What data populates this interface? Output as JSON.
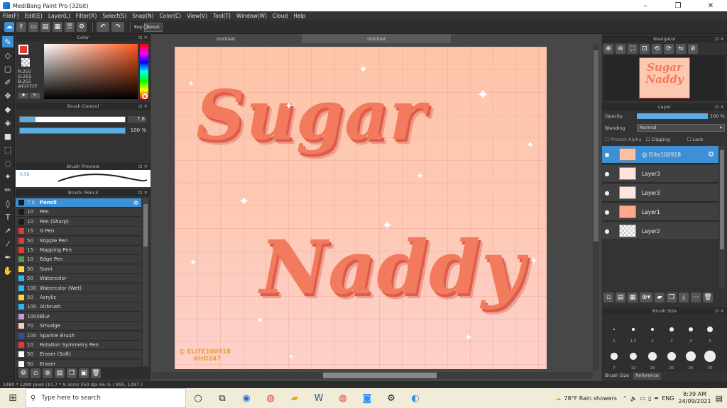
{
  "window": {
    "title": "MediBang Paint Pro (32bit)",
    "controls": [
      "–",
      "❐",
      "✕"
    ]
  },
  "menu": [
    "File(F)",
    "Edit(E)",
    "Layer(L)",
    "Filter(R)",
    "Select(S)",
    "Snap(N)",
    "Color(C)",
    "View(V)",
    "Tool(T)",
    "Window(W)",
    "Cloud",
    "Help"
  ],
  "toolbar": {
    "key_label": "Key",
    "reset_label": "Reset"
  },
  "tabs": {
    "tab1": "Untitled",
    "tab2": "Untitled"
  },
  "color_panel": {
    "title": "Color",
    "r": "R:255",
    "g": "G:255",
    "b": "B:255",
    "hex": "#FFFFFF"
  },
  "brush_control": {
    "title": "Brush Control",
    "size": "7.8",
    "opacity": "100 %",
    "size_fraction": 0.15,
    "opacity_fraction": 1.0
  },
  "brush_preview": {
    "title": "Brush Preview",
    "size": "0.56"
  },
  "brush_list": {
    "title": "Brush: Pencil",
    "items": [
      {
        "size": "7.8",
        "name": "Pencil",
        "color": "#1a1a1a",
        "selected": true
      },
      {
        "size": "10",
        "name": "Pen",
        "color": "#1a1a1a"
      },
      {
        "size": "10",
        "name": "Pen (Sharp)",
        "color": "#1a1a1a"
      },
      {
        "size": "15",
        "name": "G Pen",
        "color": "#e53935"
      },
      {
        "size": "50",
        "name": "Stipple Pen",
        "color": "#e53935"
      },
      {
        "size": "15",
        "name": "Mapping Pen",
        "color": "#e53935"
      },
      {
        "size": "10",
        "name": "Edge Pen",
        "color": "#43a047"
      },
      {
        "size": "50",
        "name": "Sumi",
        "color": "#fdd835"
      },
      {
        "size": "50",
        "name": "Watercolor",
        "color": "#29b6f6"
      },
      {
        "size": "100",
        "name": "Watercolor (Wet)",
        "color": "#29b6f6"
      },
      {
        "size": "50",
        "name": "Acrylic",
        "color": "#fdd835"
      },
      {
        "size": "100",
        "name": "Airbrush",
        "color": "#29b6f6"
      },
      {
        "size": "1000",
        "name": "Blur",
        "color": "#ce93d8"
      },
      {
        "size": "70",
        "name": "Smudge",
        "color": "#ffccbc"
      },
      {
        "size": "100",
        "name": "Sparkle Brush",
        "color": "#3949ab"
      },
      {
        "size": "10",
        "name": "Rotation Symmetry Pen",
        "color": "#e53935"
      },
      {
        "size": "50",
        "name": "Eraser (Soft)",
        "color": "#ffffff"
      },
      {
        "size": "50",
        "name": "Eraser",
        "color": "#ffffff"
      }
    ]
  },
  "artwork": {
    "word1": "Sugar",
    "word2": "Naddy",
    "watermark1": "@ ELITE100918",
    "watermark2": "#HD247"
  },
  "navigator": {
    "title": "Navigator",
    "thumb_text1": "Sugar",
    "thumb_text2": "Naddy"
  },
  "layer_panel": {
    "title": "Layer",
    "opacity_label": "Opacity",
    "opacity_value": "100 %",
    "blending_label": "Blending",
    "blending_value": "Normal",
    "protect_alpha": "Protect Alpha",
    "clipping": "Clipping",
    "lock": "Lock",
    "layers": [
      {
        "name": "@ Elite100918",
        "selected": true,
        "thumb": "#fbbfa5"
      },
      {
        "name": "Layer3",
        "thumb": "#fde4dc"
      },
      {
        "name": "Layer3",
        "thumb": "#fde4dc"
      },
      {
        "name": "Layer1",
        "thumb": "#fba988"
      },
      {
        "name": "Layer2",
        "thumb": "checker"
      }
    ]
  },
  "brush_size_panel": {
    "title": "Brush Size",
    "tab1": "Brush Size",
    "tab2": "Reference",
    "row1": [
      "1",
      "1.5",
      "2",
      "3",
      "4",
      "5"
    ],
    "row2": [
      "7",
      "12",
      "15",
      "20",
      "25",
      "30"
    ]
  },
  "status": {
    "text": "1480 * 1280 pixel  (10.7 * 9.3cm)  350 dpi  66 %  ( 895, 1287 )"
  },
  "taskbar": {
    "search_placeholder": "Type here to search",
    "weather": "78°F  Rain showers",
    "lang": "ENG",
    "time": "8:39 AM",
    "date": "24/09/2021"
  }
}
